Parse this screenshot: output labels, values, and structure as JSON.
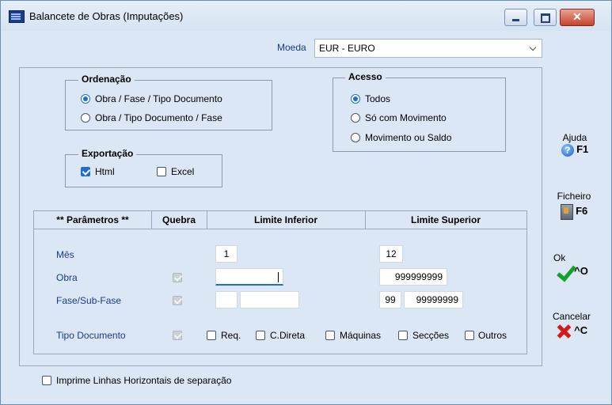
{
  "window": {
    "title": "Balancete de Obras (Imputações)"
  },
  "moeda": {
    "label": "Moeda",
    "value": "EUR - EURO"
  },
  "ordenacao": {
    "title": "Ordenação",
    "options": [
      {
        "label": "Obra / Fase / Tipo Documento",
        "selected": true
      },
      {
        "label": "Obra / Tipo Documento / Fase",
        "selected": false
      }
    ]
  },
  "acesso": {
    "title": "Acesso",
    "options": [
      {
        "label": "Todos",
        "selected": true
      },
      {
        "label": "Só com Movimento",
        "selected": false
      },
      {
        "label": "Movimento ou Saldo",
        "selected": false
      }
    ]
  },
  "exportacao": {
    "title": "Exportação",
    "options": [
      {
        "label": "Html",
        "checked": true
      },
      {
        "label": "Excel",
        "checked": false
      }
    ]
  },
  "parametros": {
    "headers": [
      "** Parâmetros **",
      "Quebra",
      "Limite Inferior",
      "Limite Superior"
    ],
    "mes": {
      "label": "Mês",
      "inferior": "1",
      "superior": "12"
    },
    "obra": {
      "label": "Obra",
      "quebra": true,
      "inferior": "",
      "superior": "999999999"
    },
    "fase": {
      "label": "Fase/Sub-Fase",
      "quebra": true,
      "inf_fase": "",
      "inf_subfase": "",
      "sup_fase": "99",
      "sup_subfase": "99999999"
    },
    "tipo_documento": {
      "label": "Tipo Documento",
      "quebra": true,
      "options": [
        {
          "label": "Req.",
          "checked": false
        },
        {
          "label": "C.Direta",
          "checked": false
        },
        {
          "label": "Máquinas",
          "checked": false
        },
        {
          "label": "Secções",
          "checked": false
        },
        {
          "label": "Outros",
          "checked": false
        }
      ]
    }
  },
  "linhas_horizontais": {
    "label": "Imprime Linhas Horizontais de separação",
    "checked": false
  },
  "side_buttons": {
    "ajuda": {
      "label": "Ajuda",
      "key": "F1"
    },
    "ficheiro": {
      "label": "Ficheiro",
      "key": "F6"
    },
    "ok": {
      "label": "Ok",
      "key": "^O"
    },
    "cancelar": {
      "label": "Cancelar",
      "key": "^C"
    }
  },
  "colors": {
    "accent": "#1c6fd0",
    "background": "#dbe7f4",
    "ok": "#14a12b",
    "cancel": "#d81818"
  }
}
